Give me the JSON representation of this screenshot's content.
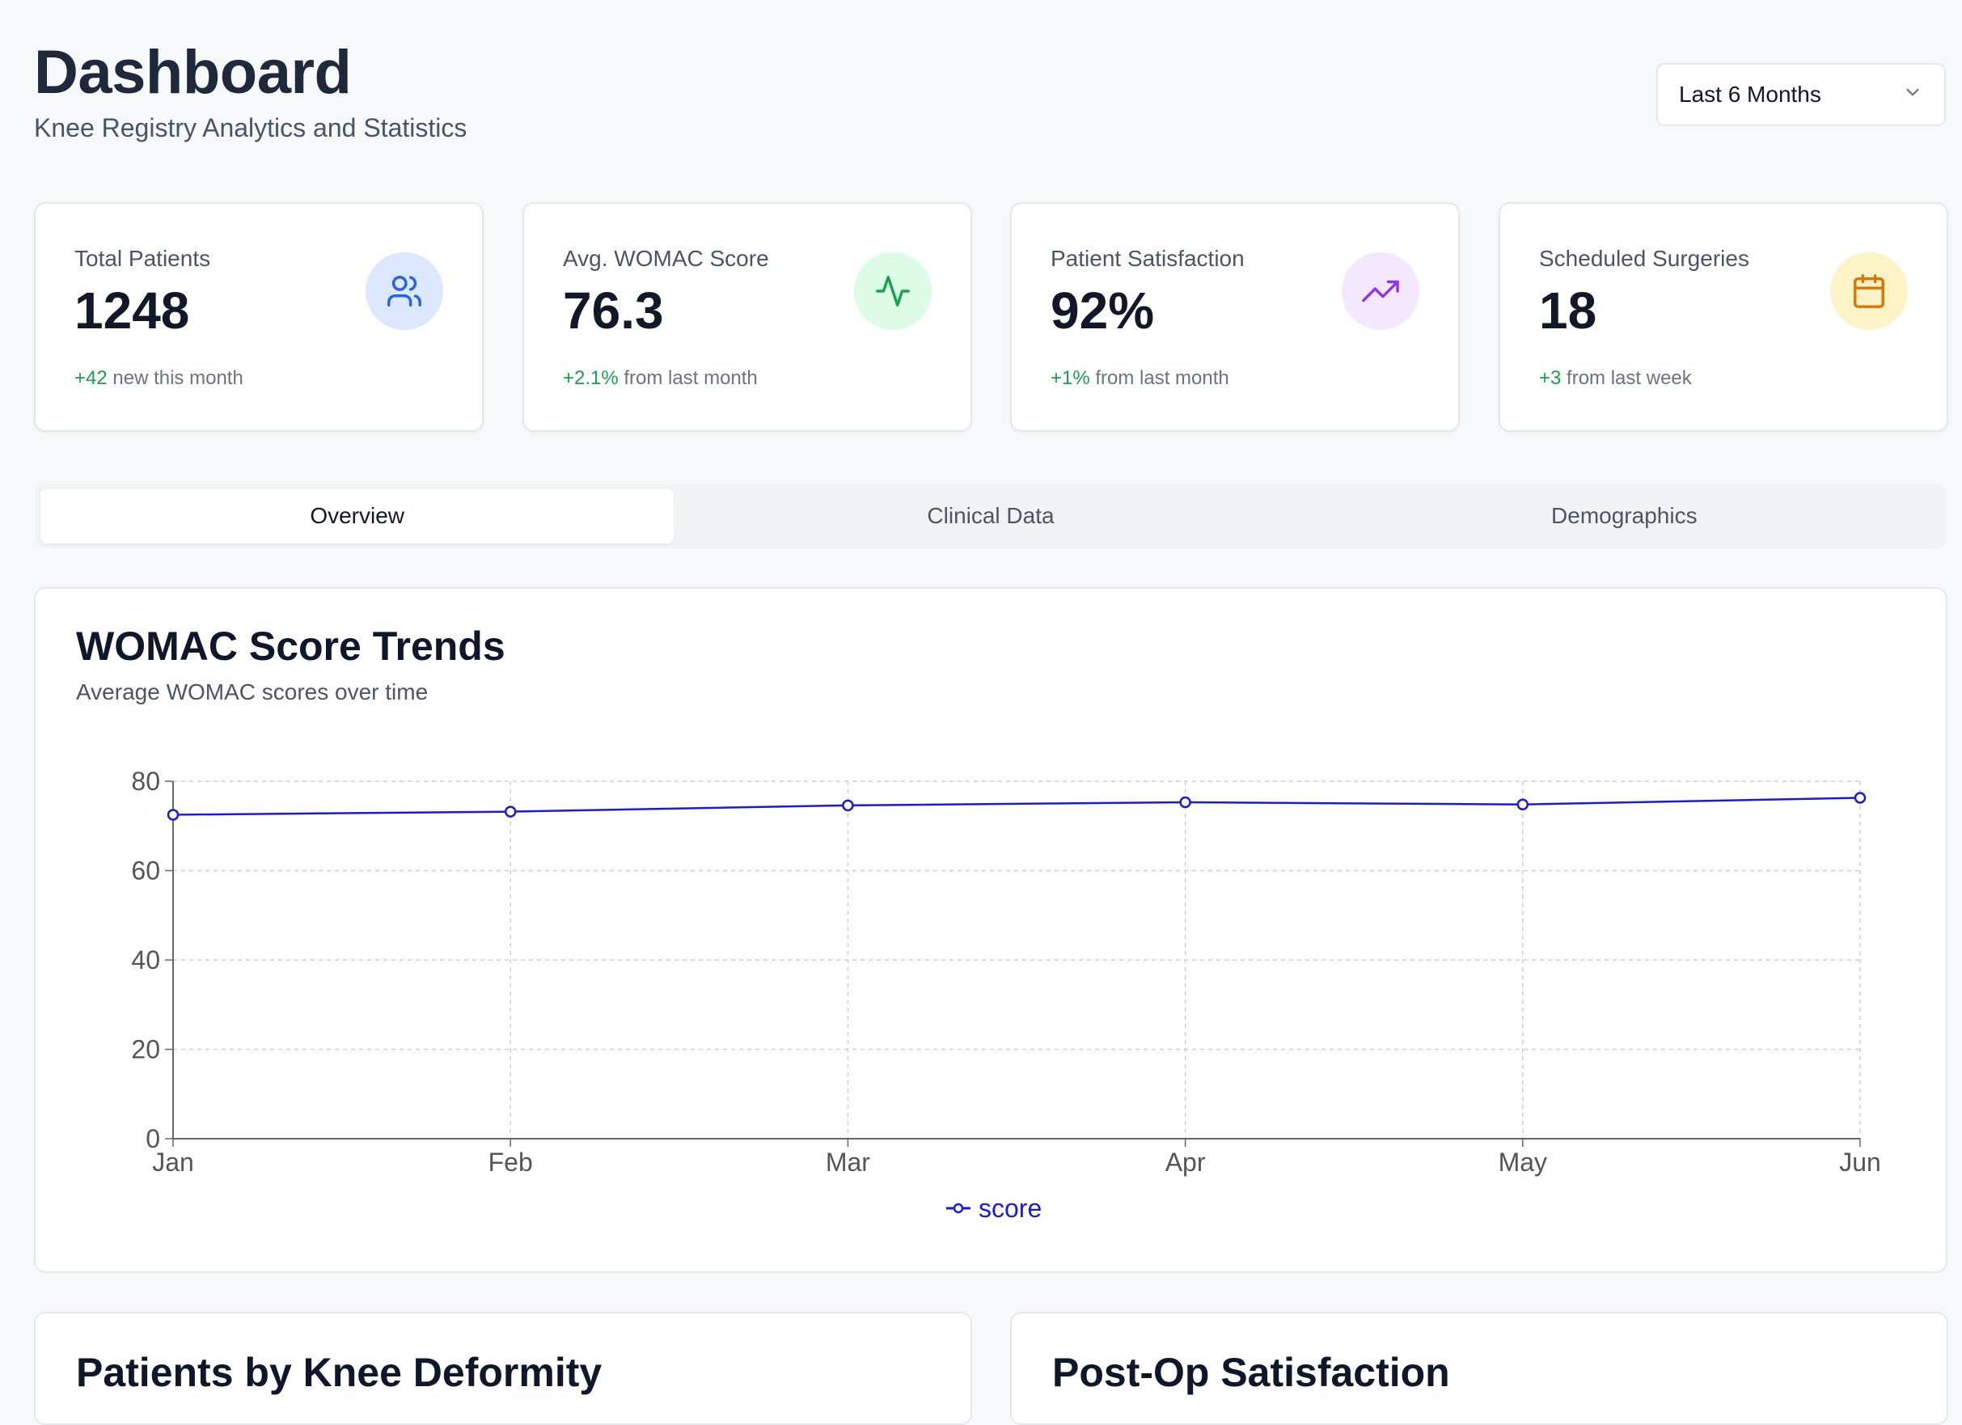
{
  "header": {
    "title": "Dashboard",
    "subtitle": "Knee Registry Analytics and Statistics"
  },
  "range_select": {
    "value": "Last 6 Months",
    "icon": "chevron-down-icon"
  },
  "stats": [
    {
      "label": "Total Patients",
      "value": "1248",
      "delta": "+42",
      "foot": "new this month",
      "icon": "users-icon",
      "icon_color": "#2563eb",
      "icon_bg": "#dbe8fd"
    },
    {
      "label": "Avg. WOMAC Score",
      "value": "76.3",
      "delta": "+2.1%",
      "foot": "from last month",
      "icon": "activity-icon",
      "icon_color": "#16a34a",
      "icon_bg": "#dcfce7"
    },
    {
      "label": "Patient Satisfaction",
      "value": "92%",
      "delta": "+1%",
      "foot": "from last month",
      "icon": "trending-up-icon",
      "icon_color": "#9333ea",
      "icon_bg": "#f3e8ff"
    },
    {
      "label": "Scheduled Surgeries",
      "value": "18",
      "delta": "+3",
      "foot": "from last week",
      "icon": "calendar-icon",
      "icon_color": "#d97706",
      "icon_bg": "#fef3c7"
    }
  ],
  "tabs": [
    {
      "label": "Overview",
      "active": true
    },
    {
      "label": "Clinical Data",
      "active": false
    },
    {
      "label": "Demographics",
      "active": false
    }
  ],
  "chart_card": {
    "title": "WOMAC Score Trends",
    "subtitle": "Average WOMAC scores over time"
  },
  "chart_data": {
    "type": "line",
    "categories": [
      "Jan",
      "Feb",
      "Mar",
      "Apr",
      "May",
      "Jun"
    ],
    "series": [
      {
        "name": "score",
        "values": [
          72.5,
          73.2,
          74.6,
          75.3,
          74.8,
          76.3
        ],
        "color": "#1a1adb"
      }
    ],
    "ylim": [
      0,
      80
    ],
    "yticks": [
      0,
      20,
      40,
      60,
      80
    ],
    "grid": true,
    "legend": "bottom-center",
    "xlabel": "",
    "ylabel": ""
  },
  "bottom_cards": [
    {
      "title": "Patients by Knee Deformity"
    },
    {
      "title": "Post-Op Satisfaction"
    }
  ]
}
